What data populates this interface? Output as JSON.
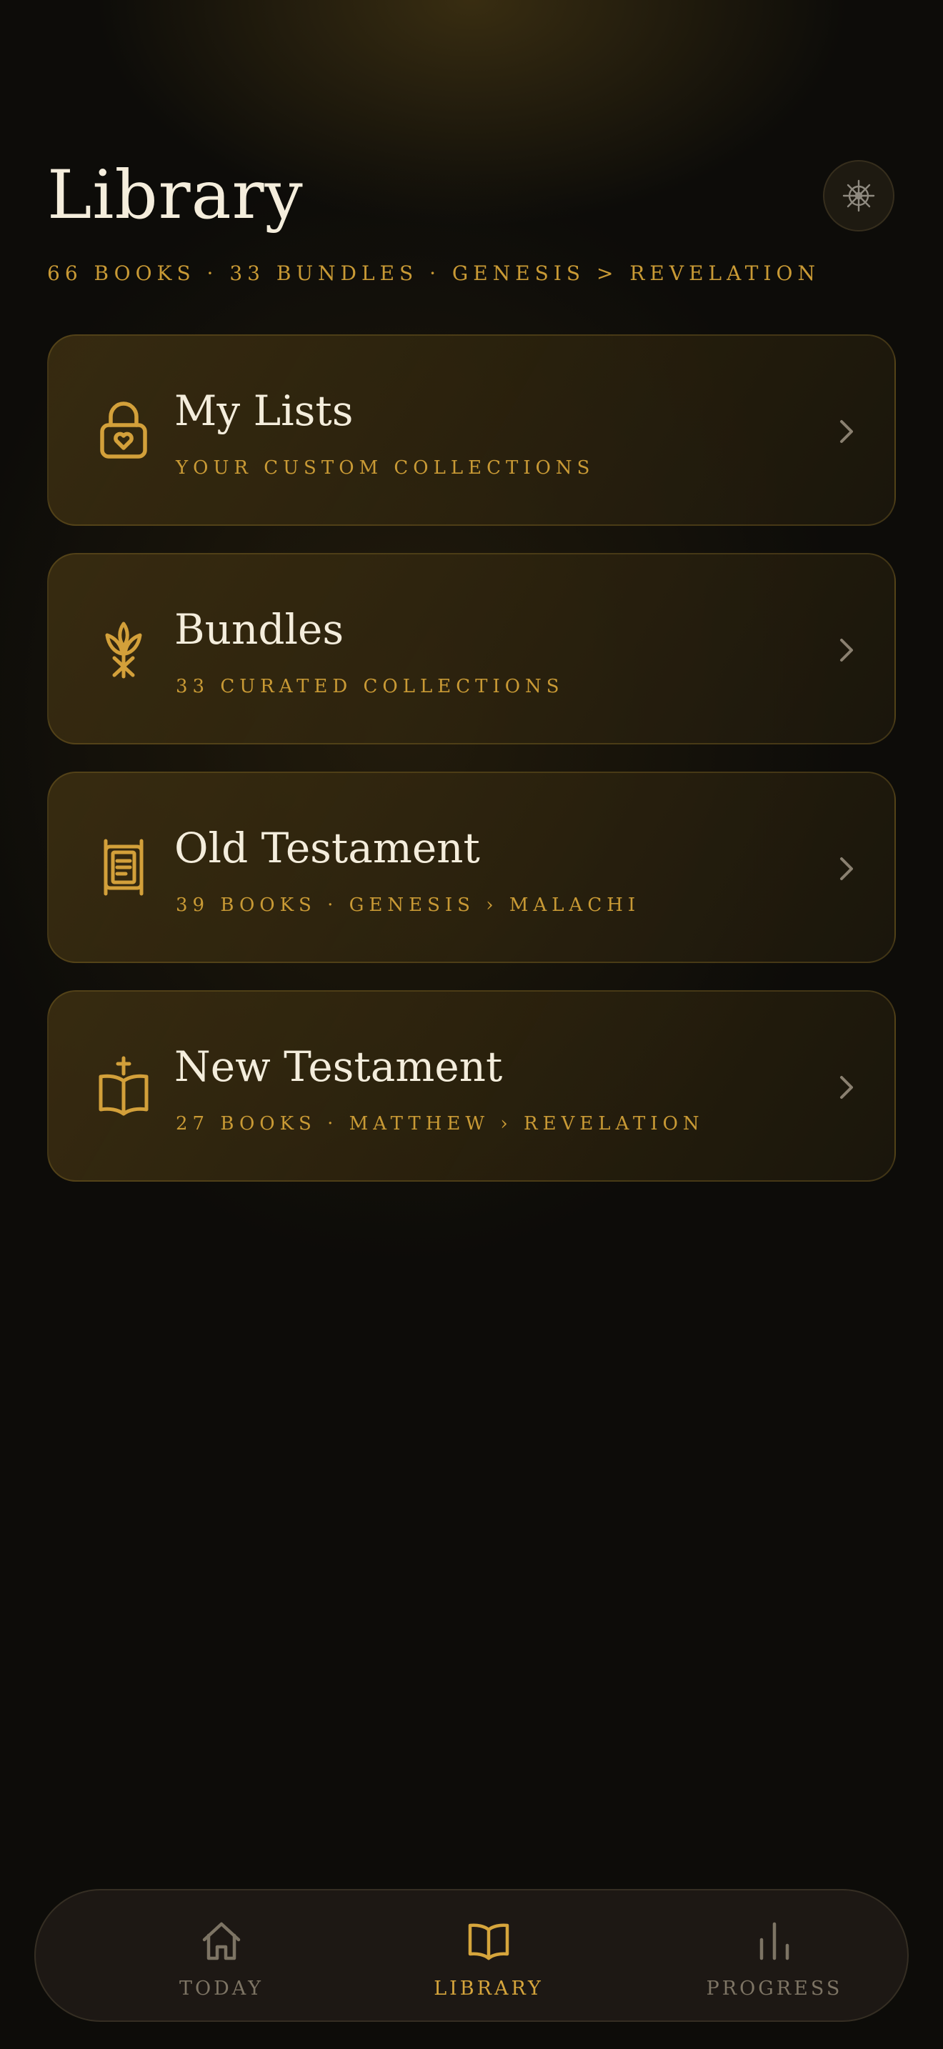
{
  "header": {
    "title": "Library",
    "subtitle": "66 BOOKS · 33 BUNDLES · GENESIS > REVELATION",
    "settings_icon": "ship-wheel-icon"
  },
  "cards": [
    {
      "title": "My Lists",
      "subtitle": "YOUR CUSTOM COLLECTIONS",
      "icon": "lock-heart-icon"
    },
    {
      "title": "Bundles",
      "subtitle": "33 CURATED COLLECTIONS",
      "icon": "wheat-icon"
    },
    {
      "title": "Old Testament",
      "subtitle": "39 BOOKS · GENESIS › MALACHI",
      "icon": "scroll-icon"
    },
    {
      "title": "New Testament",
      "subtitle": "27 BOOKS · MATTHEW › REVELATION",
      "icon": "bible-cross-icon"
    }
  ],
  "nav": {
    "items": [
      {
        "label": "TODAY",
        "icon": "home-icon",
        "active": false
      },
      {
        "label": "LIBRARY",
        "icon": "open-book-icon",
        "active": true
      },
      {
        "label": "PROGRESS",
        "icon": "bar-chart-icon",
        "active": false
      }
    ]
  },
  "colors": {
    "accent": "#c99a35",
    "text": "#f4eddc",
    "background": "#0d0c09",
    "inactive": "#7d7464"
  }
}
